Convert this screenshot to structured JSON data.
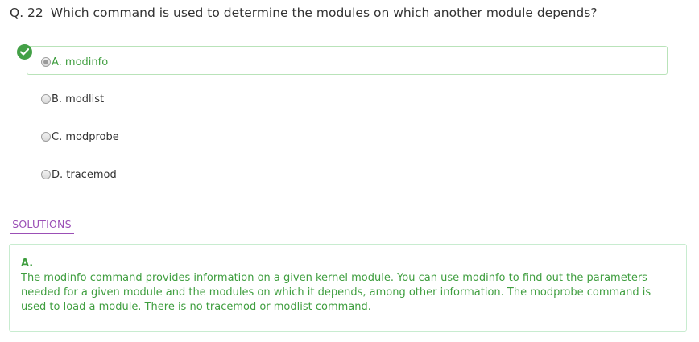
{
  "question": {
    "number": "Q. 22",
    "text": "Which command is used to determine the modules on which another module depends?"
  },
  "options": [
    {
      "label": "A. modinfo",
      "selected": true,
      "correct": true
    },
    {
      "label": "B. modlist",
      "selected": false,
      "correct": false
    },
    {
      "label": "C. modprobe",
      "selected": false,
      "correct": false
    },
    {
      "label": "D. tracemod",
      "selected": false,
      "correct": false
    }
  ],
  "icons": {
    "correct_marker": "check-circle-icon"
  },
  "solutions": {
    "tab_label": "SOLUTIONS",
    "answer": "A.",
    "explanation": "The modinfo command provides information on a given kernel module. You can use modinfo to find out the parameters needed for a given module and the modules on which it depends, among other information. The modprobe command is used to load a module. There is no tracemod or modlist command."
  },
  "colors": {
    "correct_green": "#43a047",
    "solutions_purple": "#9b4fb6",
    "text_dark": "#333333"
  }
}
